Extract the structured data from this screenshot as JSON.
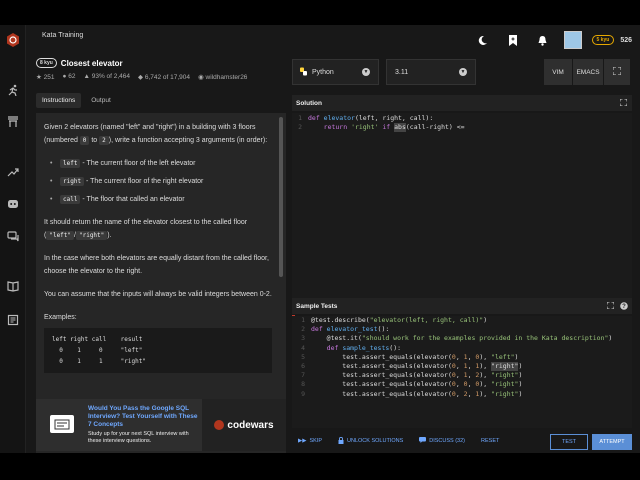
{
  "header": {
    "section_title": "Kata Training",
    "rank_badge": "5 kyu",
    "honor": "526"
  },
  "kata": {
    "kyu": "8 kyu",
    "name": "Closest elevator",
    "stats": {
      "stars": "251",
      "solutions": "62",
      "satisfaction": "93% of 2,464",
      "completed": "6,742 of 17,904",
      "author": "wildhamster26"
    },
    "tabs": [
      "Instructions",
      "Output"
    ]
  },
  "description": {
    "intro_a": "Given 2 elevators (named \"left\" and \"right\") in a building with 3 floors (numbered ",
    "intro_code1": "0",
    "intro_b": " to ",
    "intro_code2": "2",
    "intro_c": "), write a function accepting 3 arguments (in order):",
    "args": [
      {
        "code": "left",
        "text": " - The current floor of the left elevator"
      },
      {
        "code": "right",
        "text": " - The current floor of the right elevator"
      },
      {
        "code": "call",
        "text": " - The floor that called an elevator"
      }
    ],
    "return_a": "It should return the name of the elevator closest to the called floor (",
    "return_code1": "\"left\"",
    "return_b": "/",
    "return_code2": "\"right\"",
    "return_c": ").",
    "tie": "In the case where both elevators are equally distant from the called floor, choose the elevator to the right.",
    "assume": "You can assume that the inputs will always be valid integers between 0-2.",
    "examples_label": "Examples:",
    "examples_code": "left right call    result\n  0    1     0     \"left\"\n  0    1     1     \"right\""
  },
  "ad": {
    "title": "Would You Pass the Google SQL Interview? Test Yourself with These 7 Concepts",
    "subtitle": "Study up for your next SQL interview with these interview questions.",
    "brand": "codewars"
  },
  "editor": {
    "language": "Python",
    "version": "3.11",
    "vim_label": "VIM",
    "emacs_label": "EMACS",
    "solution_title": "Solution",
    "solution_lines": [
      {
        "n": "1",
        "parts": [
          {
            "c": "kw",
            "t": "def "
          },
          {
            "c": "fn",
            "t": "elevator"
          },
          {
            "c": "txt",
            "t": "(left, right, call):"
          }
        ]
      },
      {
        "n": "2",
        "parts": [
          {
            "c": "txt",
            "t": "    "
          },
          {
            "c": "kw",
            "t": "return "
          },
          {
            "c": "str",
            "t": "'right'"
          },
          {
            "c": "kw",
            "t": " if "
          },
          {
            "c": "hl",
            "t": "abs"
          },
          {
            "c": "txt",
            "t": "(call-right) <="
          }
        ]
      }
    ],
    "tests_title": "Sample Tests",
    "test_lines": [
      {
        "n": "1",
        "parts": [
          {
            "c": "txt",
            "t": "@test.describe("
          },
          {
            "c": "str",
            "t": "\"elevator(left, right, call)\""
          },
          {
            "c": "txt",
            "t": ")"
          }
        ]
      },
      {
        "n": "2",
        "parts": [
          {
            "c": "kw",
            "t": "def "
          },
          {
            "c": "fn",
            "t": "elevator_test"
          },
          {
            "c": "txt",
            "t": "():"
          }
        ]
      },
      {
        "n": "3",
        "parts": [
          {
            "c": "txt",
            "t": "    @test.it("
          },
          {
            "c": "str",
            "t": "\"should work for the examples provided in the Kata description\""
          },
          {
            "c": "txt",
            "t": ")"
          }
        ]
      },
      {
        "n": "4",
        "parts": [
          {
            "c": "txt",
            "t": "    "
          },
          {
            "c": "kw",
            "t": "def "
          },
          {
            "c": "fn",
            "t": "sample_tests"
          },
          {
            "c": "txt",
            "t": "():"
          }
        ]
      },
      {
        "n": "5",
        "parts": [
          {
            "c": "txt",
            "t": "        test.assert_equals(elevator("
          },
          {
            "c": "num",
            "t": "0"
          },
          {
            "c": "txt",
            "t": ", "
          },
          {
            "c": "num",
            "t": "1"
          },
          {
            "c": "txt",
            "t": ", "
          },
          {
            "c": "num",
            "t": "0"
          },
          {
            "c": "txt",
            "t": "), "
          },
          {
            "c": "str",
            "t": "\"left\""
          },
          {
            "c": "txt",
            "t": ")"
          }
        ]
      },
      {
        "n": "6",
        "parts": [
          {
            "c": "txt",
            "t": "        test.assert_equals(elevator("
          },
          {
            "c": "num",
            "t": "0"
          },
          {
            "c": "txt",
            "t": ", "
          },
          {
            "c": "num",
            "t": "1"
          },
          {
            "c": "txt",
            "t": ", "
          },
          {
            "c": "num",
            "t": "1"
          },
          {
            "c": "txt",
            "t": "), "
          },
          {
            "c": "hl",
            "t": "\"right\""
          },
          {
            "c": "txt",
            "t": ")"
          }
        ]
      },
      {
        "n": "7",
        "parts": [
          {
            "c": "txt",
            "t": "        test.assert_equals(elevator("
          },
          {
            "c": "num",
            "t": "0"
          },
          {
            "c": "txt",
            "t": ", "
          },
          {
            "c": "num",
            "t": "1"
          },
          {
            "c": "txt",
            "t": ", "
          },
          {
            "c": "num",
            "t": "2"
          },
          {
            "c": "txt",
            "t": "), "
          },
          {
            "c": "str",
            "t": "\"right\""
          },
          {
            "c": "txt",
            "t": ")"
          }
        ]
      },
      {
        "n": "8",
        "parts": [
          {
            "c": "txt",
            "t": "        test.assert_equals(elevator("
          },
          {
            "c": "num",
            "t": "0"
          },
          {
            "c": "txt",
            "t": ", "
          },
          {
            "c": "num",
            "t": "0"
          },
          {
            "c": "txt",
            "t": ", "
          },
          {
            "c": "num",
            "t": "0"
          },
          {
            "c": "txt",
            "t": "), "
          },
          {
            "c": "str",
            "t": "\"right\""
          },
          {
            "c": "txt",
            "t": ")"
          }
        ]
      },
      {
        "n": "9",
        "parts": [
          {
            "c": "txt",
            "t": "        test.assert_equals(elevator("
          },
          {
            "c": "num",
            "t": "0"
          },
          {
            "c": "txt",
            "t": ", "
          },
          {
            "c": "num",
            "t": "2"
          },
          {
            "c": "txt",
            "t": ", "
          },
          {
            "c": "num",
            "t": "1"
          },
          {
            "c": "txt",
            "t": "), "
          },
          {
            "c": "str",
            "t": "\"right\""
          },
          {
            "c": "txt",
            "t": ")"
          }
        ]
      }
    ]
  },
  "actions": {
    "skip": "SKIP",
    "unlock": "UNLOCK SOLUTIONS",
    "discuss": "DISCUSS (32)",
    "reset": "RESET",
    "test": "TEST",
    "attempt": "ATTEMPT"
  },
  "colors": {
    "accent_blue": "#6fa8ff",
    "attempt_bg": "#5b8fd6",
    "rank_yellow": "#e6a800",
    "brand_red": "#b1361e"
  }
}
